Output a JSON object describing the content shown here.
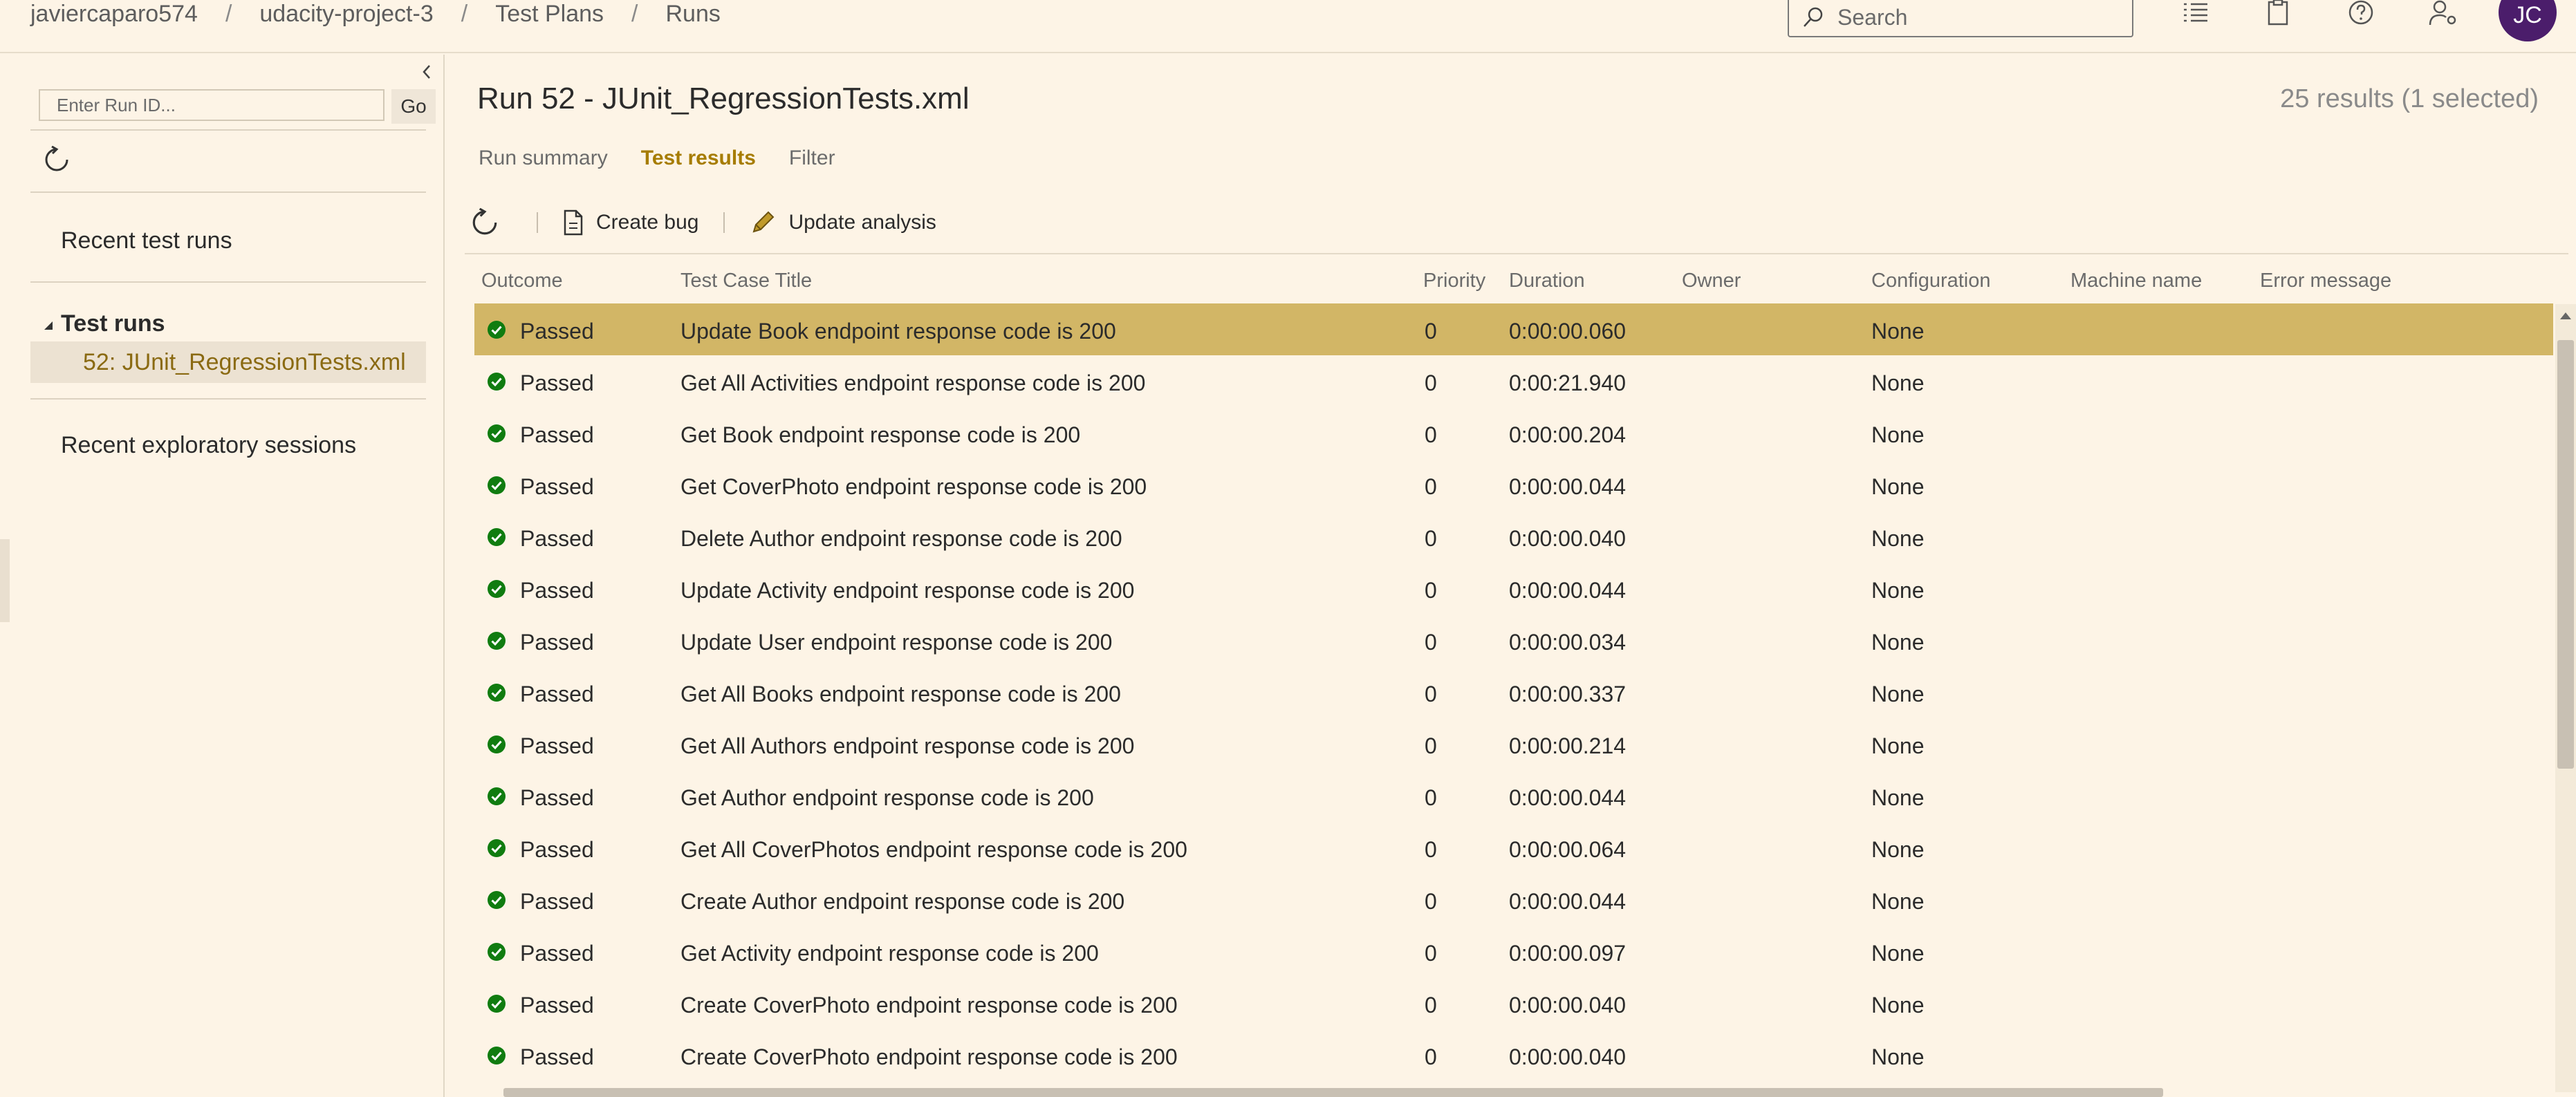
{
  "breadcrumb": [
    "javiercaparo574",
    "udacity-project-3",
    "Test Plans",
    "Runs"
  ],
  "breadcrumb_separator": "/",
  "search": {
    "placeholder": "Search"
  },
  "header_icons": [
    "task-list-icon",
    "clipboard-icon",
    "help-icon",
    "user-settings-icon"
  ],
  "user": {
    "initials": "JC",
    "avatar_color": "#4b1d6b"
  },
  "left_panel": {
    "run_id_placeholder": "Enter Run ID...",
    "go_label": "Go",
    "recent_test_runs": "Recent test runs",
    "test_runs_header": "Test runs",
    "selected_run": "52: JUnit_RegressionTests.xml",
    "recent_exploratory_sessions": "Recent exploratory sessions"
  },
  "main": {
    "title": "Run 52 - JUnit_RegressionTests.xml",
    "results_count": "25 results (1 selected)",
    "tabs": [
      {
        "label": "Run summary",
        "active": false
      },
      {
        "label": "Test results",
        "active": true
      },
      {
        "label": "Filter",
        "active": false
      }
    ],
    "toolbar": {
      "create_bug": "Create bug",
      "update_analysis": "Update analysis"
    },
    "columns": {
      "outcome": "Outcome",
      "title": "Test Case Title",
      "priority": "Priority",
      "duration": "Duration",
      "owner": "Owner",
      "configuration": "Configuration",
      "machine": "Machine name",
      "error": "Error message"
    },
    "rows": [
      {
        "outcome": "Passed",
        "title": "Update Book endpoint response code is 200",
        "priority": "0",
        "duration": "0:00:00.060",
        "owner": "",
        "configuration": "None",
        "selected": true
      },
      {
        "outcome": "Passed",
        "title": "Get All Activities endpoint response code is 200",
        "priority": "0",
        "duration": "0:00:21.940",
        "owner": "",
        "configuration": "None",
        "selected": false
      },
      {
        "outcome": "Passed",
        "title": "Get Book endpoint response code is 200",
        "priority": "0",
        "duration": "0:00:00.204",
        "owner": "",
        "configuration": "None",
        "selected": false
      },
      {
        "outcome": "Passed",
        "title": "Get CoverPhoto endpoint response code is 200",
        "priority": "0",
        "duration": "0:00:00.044",
        "owner": "",
        "configuration": "None",
        "selected": false
      },
      {
        "outcome": "Passed",
        "title": "Delete Author endpoint response code is 200",
        "priority": "0",
        "duration": "0:00:00.040",
        "owner": "",
        "configuration": "None",
        "selected": false
      },
      {
        "outcome": "Passed",
        "title": "Update Activity endpoint response code is 200",
        "priority": "0",
        "duration": "0:00:00.044",
        "owner": "",
        "configuration": "None",
        "selected": false
      },
      {
        "outcome": "Passed",
        "title": "Update User endpoint response code is 200",
        "priority": "0",
        "duration": "0:00:00.034",
        "owner": "",
        "configuration": "None",
        "selected": false
      },
      {
        "outcome": "Passed",
        "title": "Get All Books endpoint response code is 200",
        "priority": "0",
        "duration": "0:00:00.337",
        "owner": "",
        "configuration": "None",
        "selected": false
      },
      {
        "outcome": "Passed",
        "title": "Get All Authors endpoint response code is 200",
        "priority": "0",
        "duration": "0:00:00.214",
        "owner": "",
        "configuration": "None",
        "selected": false
      },
      {
        "outcome": "Passed",
        "title": "Get Author endpoint response code is 200",
        "priority": "0",
        "duration": "0:00:00.044",
        "owner": "",
        "configuration": "None",
        "selected": false
      },
      {
        "outcome": "Passed",
        "title": "Get All CoverPhotos endpoint response code is 200",
        "priority": "0",
        "duration": "0:00:00.064",
        "owner": "",
        "configuration": "None",
        "selected": false
      },
      {
        "outcome": "Passed",
        "title": "Create Author endpoint response code is 200",
        "priority": "0",
        "duration": "0:00:00.044",
        "owner": "",
        "configuration": "None",
        "selected": false
      },
      {
        "outcome": "Passed",
        "title": "Get Activity endpoint response code is 200",
        "priority": "0",
        "duration": "0:00:00.097",
        "owner": "",
        "configuration": "None",
        "selected": false
      },
      {
        "outcome": "Passed",
        "title": "Create CoverPhoto endpoint response code is 200",
        "priority": "0",
        "duration": "0:00:00.040",
        "owner": "",
        "configuration": "None",
        "selected": false
      },
      {
        "outcome": "Passed",
        "title": "Create CoverPhoto endpoint response code is 200",
        "priority": "0",
        "duration": "0:00:00.040",
        "owner": "",
        "configuration": "None",
        "selected": false
      }
    ]
  },
  "colors": {
    "accent": "#a67c00",
    "selected_row": "#d2b666",
    "passed": "#107c10",
    "background": "#fdf4e6"
  }
}
